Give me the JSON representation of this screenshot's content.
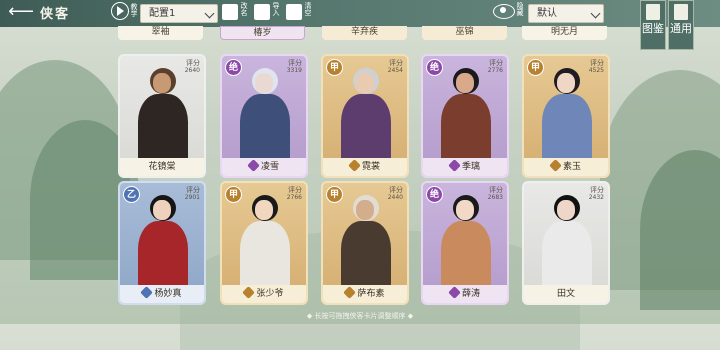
{
  "header": {
    "back_icon": "back-arrow-icon",
    "title": "侠客",
    "intro_label": "教学",
    "preset_select": "配置1",
    "tools": [
      {
        "icon": "brush-icon",
        "label": "改名"
      },
      {
        "icon": "import-icon",
        "label": "导入"
      },
      {
        "icon": "trash-icon",
        "label": "清空"
      }
    ],
    "eye_label": "隐藏",
    "sort_select": "默认",
    "side_buttons": [
      {
        "icon": "atlas-icon",
        "label": "图鉴"
      },
      {
        "icon": "general-icon",
        "label": "通用"
      }
    ]
  },
  "top_row": [
    {
      "name": "翠袖",
      "style": "white"
    },
    {
      "name": "椿岁",
      "style": "purple",
      "weapon": "swirl-icon"
    },
    {
      "name": "辛弃疾",
      "style": "gold",
      "weapon": "blade-icon"
    },
    {
      "name": "巫锦",
      "style": "gold",
      "weapon": "blade-icon"
    },
    {
      "name": "明无月",
      "style": "white"
    }
  ],
  "cards": [
    {
      "name": "花镜棠",
      "style": "white",
      "grade": "",
      "score_label": "评分",
      "score": "2640",
      "weapon": "",
      "art": "whip-swordsman"
    },
    {
      "name": "凌雪",
      "style": "purple",
      "grade": "绝",
      "score_label": "评分",
      "score": "3319",
      "weapon": "blade-icon",
      "art": "white-hair-maiden"
    },
    {
      "name": "霓裳",
      "style": "gold",
      "grade": "甲",
      "score_label": "评分",
      "score": "2454",
      "weapon": "blade-icon",
      "art": "silver-hair-priestess"
    },
    {
      "name": "季璃",
      "style": "purple",
      "grade": "绝",
      "score_label": "评分",
      "score": "2776",
      "weapon": "blade-icon",
      "art": "dark-dancer"
    },
    {
      "name": "素玉",
      "style": "gold",
      "grade": "甲",
      "score_label": "评分",
      "score": "4525",
      "weapon": "blade-icon",
      "art": "blue-robed-lady"
    },
    {
      "name": "杨妙真",
      "style": "blue",
      "grade": "乙",
      "score_label": "评分",
      "score": "2901",
      "weapon": "swirl-icon",
      "art": "red-spear-maiden"
    },
    {
      "name": "张少爷",
      "style": "gold",
      "grade": "甲",
      "score_label": "评分",
      "score": "2766",
      "weapon": "blade-icon",
      "art": "young-master-gun"
    },
    {
      "name": "萨布素",
      "style": "gold",
      "grade": "甲",
      "score_label": "评分",
      "score": "2440",
      "weapon": "blade-icon",
      "art": "fur-general"
    },
    {
      "name": "薛涛",
      "style": "purple",
      "grade": "绝",
      "score_label": "评分",
      "score": "2683",
      "weapon": "blade-icon",
      "art": "flute-lady"
    },
    {
      "name": "田文",
      "style": "white",
      "grade": "",
      "score_label": "评分",
      "score": "2432",
      "weapon": "",
      "art": "white-robed-swordsman"
    }
  ],
  "hint": "◆ 长按可拖拽侠客卡片调整顺序 ◆",
  "colors": {
    "topbar": "#54766d",
    "purple": "#8b4aa8",
    "gold": "#b7812f",
    "blue": "#4f74b3"
  }
}
